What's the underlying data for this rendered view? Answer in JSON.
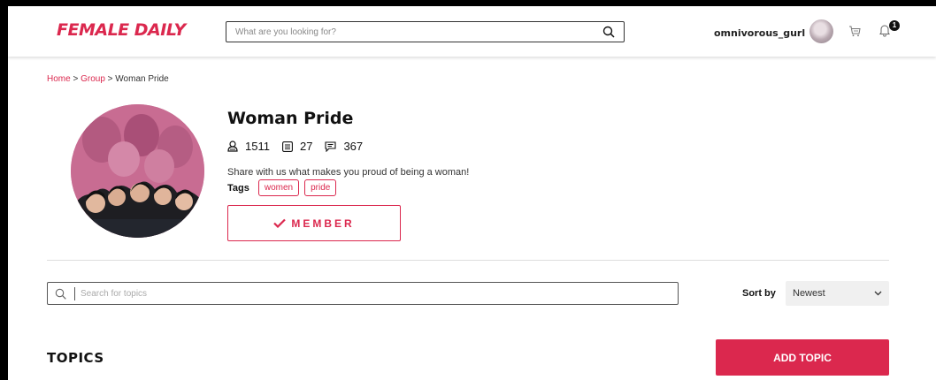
{
  "header": {
    "logo_text": "FEMALE DAILY",
    "search_placeholder": "What are you looking for?",
    "username": "omnivorous_gurl",
    "notification_count": "1",
    "icons": {
      "search": "search-icon",
      "cart": "cart-icon",
      "bell": "bell-icon"
    }
  },
  "breadcrumb": {
    "home": "Home",
    "group": "Group",
    "current": "Woman Pride",
    "separator": ">"
  },
  "group": {
    "title": "Woman Pride",
    "members_count": "1511",
    "posts_count": "27",
    "comments_count": "367",
    "description": "Share with us what makes you proud of being a woman!",
    "tags_label": "Tags",
    "tags": [
      "women",
      "pride"
    ],
    "member_button_label": "MEMBER"
  },
  "topics": {
    "search_placeholder": "Search for topics",
    "sort_label": "Sort by",
    "sort_value": "Newest",
    "heading": "TOPICS",
    "add_button_label": "ADD TOPIC"
  },
  "colors": {
    "accent": "#db284e",
    "photo_tint": "#c86c92"
  }
}
